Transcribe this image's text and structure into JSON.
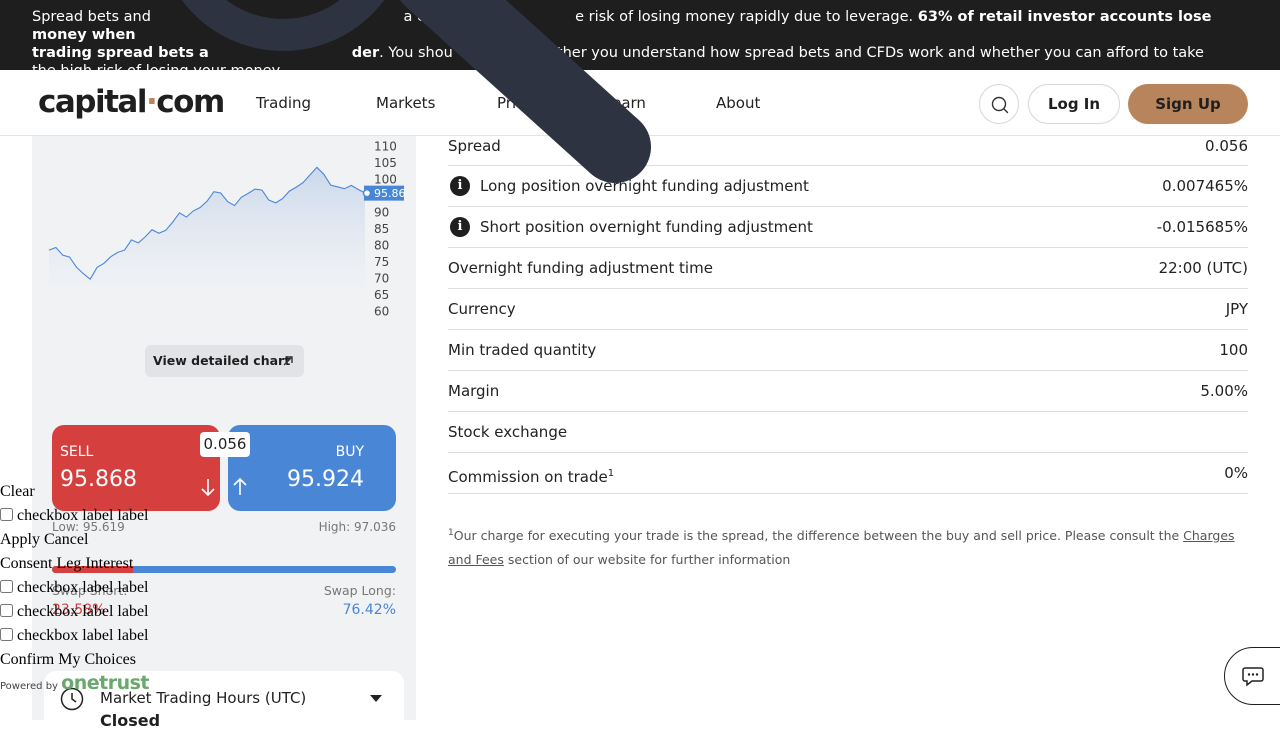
{
  "risk_banner": {
    "part1": "Spread bets and ",
    "part2": "a con",
    "part3": "e risk of losing money rapidly due to leverage. ",
    "bold1": "63% of retail investor accounts lose money when",
    "bold2": "trading spread bets a",
    "bold3": "der",
    "part4": ". You shou",
    "part5": "hether you understand how spread bets and CFDs work and whether you can afford to take",
    "part6": "the high risk of losing your money."
  },
  "nav": {
    "logo_left": "capital",
    "logo_dot": "·",
    "logo_right": "com",
    "items": [
      "Trading",
      "Markets",
      "Prici",
      "Learn",
      "About"
    ],
    "login_label": "Log In",
    "signup_label": "Sign Up"
  },
  "chart_data": {
    "type": "area",
    "ylim": [
      60,
      110
    ],
    "ytick_labels": [
      "110",
      "105",
      "100",
      "95",
      "90",
      "85",
      "80",
      "75",
      "70",
      "65",
      "60"
    ],
    "current_label": "95.86",
    "current_value": 95.868,
    "values": [
      78.6,
      79.4,
      77.1,
      76.5,
      73.4,
      71.5,
      69.8,
      73.4,
      74.6,
      76.6,
      77.9,
      78.6,
      81.7,
      80.8,
      82.6,
      84.8,
      83.7,
      84.6,
      87.1,
      89.9,
      88.6,
      90.5,
      91.5,
      93.4,
      96.3,
      95.9,
      93.3,
      92.1,
      94.6,
      95.8,
      97.1,
      96.8,
      93.8,
      92.9,
      94.2,
      96.5,
      97.7,
      99.1,
      101.4,
      103.7,
      101.6,
      98.3,
      97.8,
      97.2,
      98.2,
      97.0,
      95.9
    ]
  },
  "left_panel": {
    "detailed_chart_label": "View detailed chart",
    "sell_label": "SELL",
    "sell_price": "95.868",
    "buy_label": "BUY",
    "buy_price": "95.924",
    "spread_pill": "0.056",
    "low": "Low: 95.619",
    "high": "High: 97.036",
    "swap_short_label": "Swap Short:",
    "swap_short_value": "23.58%",
    "swap_short_fraction": 0.2358,
    "swap_long_label": "Swap Long:",
    "swap_long_value": "76.42%",
    "hours_title": "Market Trading Hours (UTC)",
    "hours_status": "Closed"
  },
  "specs": [
    {
      "label": "Spread",
      "value": "0.056",
      "icon": false
    },
    {
      "label": "Long position overnight funding adjustment",
      "value": "0.007465%",
      "icon": true
    },
    {
      "label": "Short position overnight funding adjustment",
      "value": "-0.015685%",
      "icon": true
    },
    {
      "label": "Overnight funding adjustment time",
      "value": "22:00 (UTC)",
      "icon": false
    },
    {
      "label": "Currency",
      "value": "JPY",
      "icon": false
    },
    {
      "label": "Min traded quantity",
      "value": "100",
      "icon": false
    },
    {
      "label": "Margin",
      "value": "5.00%",
      "icon": false
    },
    {
      "label": "Stock exchange",
      "value": "",
      "icon": false
    },
    {
      "label": "Commission on trade",
      "value": "0%",
      "icon": false,
      "sup": "1"
    }
  ],
  "info_glyph": "i",
  "footnote": {
    "sup": "1",
    "text1": "Our charge for executing your trade is the spread, the difference between the buy and sell price. Please consult the ",
    "link": "Charges and Fees",
    "text2": " section of our website for further information"
  },
  "consent": {
    "clear": "Clear",
    "checkbox_label": "checkbox label label",
    "apply": "Apply",
    "cancel": "Cancel",
    "legit": "Consent Leg.Interest",
    "confirm": "Confirm My Choices",
    "powered_by": "Powered by",
    "brand": "onetrust"
  },
  "colors": {
    "sell": "#d5403f",
    "buy": "#4a86d6",
    "brand": "#b8845c",
    "banner": "#1e1e1e"
  }
}
